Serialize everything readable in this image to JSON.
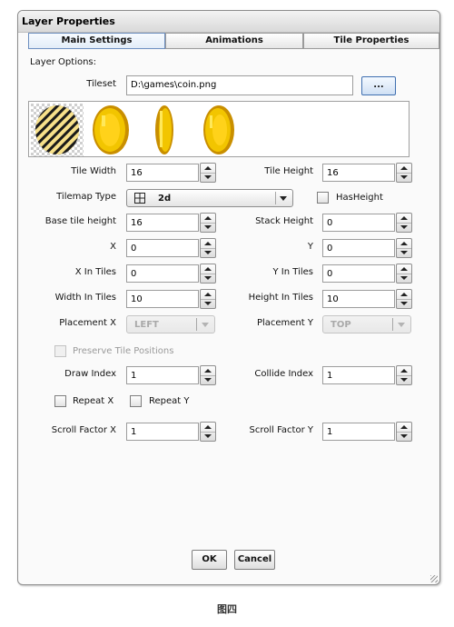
{
  "window": {
    "title": "Layer Properties"
  },
  "tabs": [
    {
      "label": "Main Settings",
      "active": true
    },
    {
      "label": "Animations",
      "active": false
    },
    {
      "label": "Tile Properties",
      "active": false
    }
  ],
  "layer_options_label": "Layer Options:",
  "tileset": {
    "label": "Tileset",
    "value": "D:\\games\\coin.png",
    "browse_label": "..."
  },
  "tile_icons": [
    "coin-tile-selected-icon",
    "coin-front-icon",
    "coin-side-icon",
    "coin-three-quarter-icon"
  ],
  "fields": {
    "tile_width": {
      "label": "Tile Width",
      "value": "16"
    },
    "tile_height": {
      "label": "Tile Height",
      "value": "16"
    },
    "base_tile_height": {
      "label": "Base tile height",
      "value": "16"
    },
    "stack_height": {
      "label": "Stack Height",
      "value": "0"
    },
    "x": {
      "label": "X",
      "value": "0"
    },
    "y": {
      "label": "Y",
      "value": "0"
    },
    "x_in_tiles": {
      "label": "X In Tiles",
      "value": "0"
    },
    "y_in_tiles": {
      "label": "Y In Tiles",
      "value": "0"
    },
    "width_in_tiles": {
      "label": "Width In Tiles",
      "value": "10"
    },
    "height_in_tiles": {
      "label": "Height In Tiles",
      "value": "10"
    },
    "draw_index": {
      "label": "Draw Index",
      "value": "1"
    },
    "collide_index": {
      "label": "Collide Index",
      "value": "1"
    },
    "scroll_factor_x": {
      "label": "Scroll Factor X",
      "value": "1"
    },
    "scroll_factor_y": {
      "label": "Scroll Factor Y",
      "value": "1"
    }
  },
  "tilemap_type": {
    "label": "Tilemap Type",
    "value": "2d",
    "icon": "grid-icon"
  },
  "has_height": {
    "label": "HasHeight",
    "checked": false
  },
  "placement_x": {
    "label": "Placement X",
    "value": "LEFT",
    "disabled": true
  },
  "placement_y": {
    "label": "Placement Y",
    "value": "TOP",
    "disabled": true
  },
  "preserve_tile_positions": {
    "label": "Preserve Tile Positions",
    "checked": false,
    "disabled": true
  },
  "repeat_x": {
    "label": "Repeat X",
    "checked": false
  },
  "repeat_y": {
    "label": "Repeat Y",
    "checked": false
  },
  "buttons": {
    "ok": "OK",
    "cancel": "Cancel"
  },
  "caption": "图四",
  "colors": {
    "coin_gold": "#f2c500",
    "coin_dark": "#c98f00",
    "coin_light": "#ffe85a",
    "tab_active_border": "#6d8fc0"
  }
}
